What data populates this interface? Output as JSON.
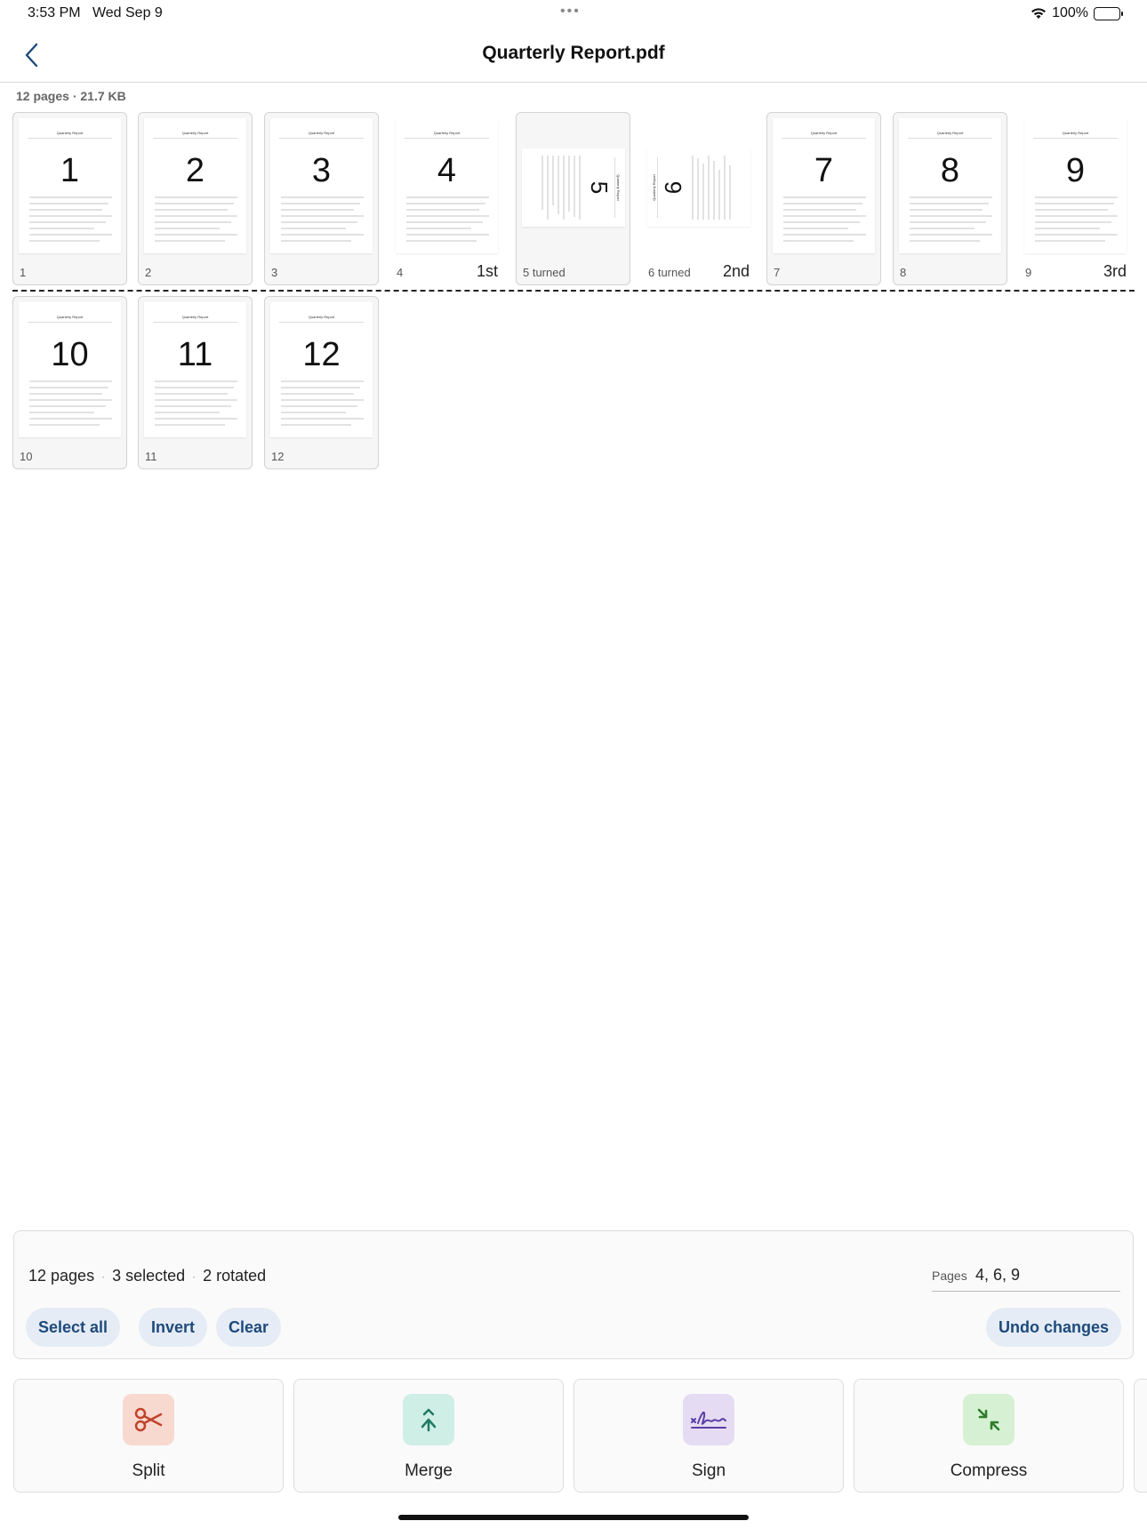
{
  "status_bar": {
    "time": "3:53 PM",
    "date": "Wed Sep 9",
    "battery": "100%"
  },
  "nav": {
    "title": "Quarterly Report.pdf"
  },
  "document": {
    "meta": "12 pages · 21.7 KB",
    "thumb_title": "Quarterly Report"
  },
  "pages": [
    {
      "number": "1",
      "label": "1",
      "order": "",
      "rotated": false,
      "selected": false
    },
    {
      "number": "2",
      "label": "2",
      "order": "",
      "rotated": false,
      "selected": false
    },
    {
      "number": "3",
      "label": "3",
      "order": "",
      "rotated": false,
      "selected": false
    },
    {
      "number": "4",
      "label": "4",
      "order": "1st",
      "rotated": false,
      "selected": true
    },
    {
      "number": "5",
      "label": "5  turned",
      "order": "",
      "rotated": true,
      "rotation": 90,
      "selected": false
    },
    {
      "number": "6",
      "label": "6  turned",
      "order": "2nd",
      "rotated": true,
      "rotation": 270,
      "selected": true
    },
    {
      "number": "7",
      "label": "7",
      "order": "",
      "rotated": false,
      "selected": false
    },
    {
      "number": "8",
      "label": "8",
      "order": "",
      "rotated": false,
      "selected": false
    },
    {
      "number": "9",
      "label": "9",
      "order": "3rd",
      "rotated": false,
      "selected": true
    },
    {
      "number": "10",
      "label": "10",
      "order": "",
      "rotated": false,
      "selected": false
    },
    {
      "number": "11",
      "label": "11",
      "order": "",
      "rotated": false,
      "selected": false
    },
    {
      "number": "12",
      "label": "12",
      "order": "",
      "rotated": false,
      "selected": false
    }
  ],
  "selection": {
    "total": "12 pages",
    "selected": "3 selected",
    "rotated": "2 rotated",
    "pages_label": "Pages",
    "pages_value": "4, 6, 9",
    "select_all": "Select all",
    "invert": "Invert",
    "clear": "Clear",
    "undo": "Undo changes"
  },
  "tools": [
    {
      "label": "Split",
      "icon": "scissors-icon",
      "bg": "#f8d9d0",
      "fg": "#c0432a"
    },
    {
      "label": "Merge",
      "icon": "merge-icon",
      "bg": "#cfeee6",
      "fg": "#1e7a63"
    },
    {
      "label": "Sign",
      "icon": "signature-icon",
      "bg": "#e5dcf4",
      "fg": "#5b3ea6"
    },
    {
      "label": "Compress",
      "icon": "compress-icon",
      "bg": "#d6f0d3",
      "fg": "#2f7d2c"
    }
  ]
}
